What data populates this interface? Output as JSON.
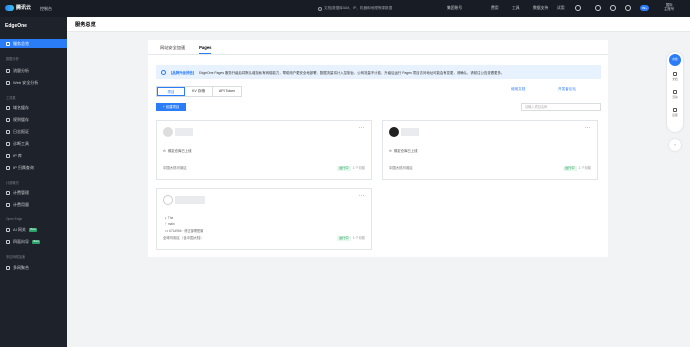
{
  "topbar": {
    "logo": "腾讯云",
    "console": "控制台",
    "search_placeholder": "文档|数据库IAM、IP、机器和地理等源数据",
    "nav": [
      "集团账号",
      "费用",
      "工具",
      "数据支持",
      "试用"
    ],
    "notif_count": "99+",
    "user_line1": "国际",
    "user_line2": "主账号"
  },
  "sidebar": {
    "title": "EdgeOne",
    "items": [
      {
        "label": "服务总览",
        "active": true
      },
      {
        "label": "数据分析"
      },
      {
        "label": "流量分析"
      },
      {
        "label": "Web 安全分析"
      },
      {
        "label": "域名缓存"
      },
      {
        "label": "规则缓存"
      },
      {
        "label": "日志报证"
      },
      {
        "label": "诊断工具"
      },
      {
        "label": "IP 库"
      },
      {
        "label": "IP 归属查询"
      },
      {
        "label": "计费管理"
      },
      {
        "label": "计费用量"
      },
      {
        "label": "AI 网关",
        "badge": "Beta"
      },
      {
        "label": "四面向导",
        "badge": "Beta"
      },
      {
        "label": "多网聚合"
      }
    ],
    "sections": [
      "数据分析",
      "工具集",
      "计费概况",
      "Open Edge",
      "多边网络加速"
    ]
  },
  "page": {
    "title": "服务总览"
  },
  "tabs": [
    "网站安全加速",
    "Pages"
  ],
  "notice": {
    "highlight": "【品牌升级预告】",
    "text": "EdgeOne Pages 服务升级后将默认增加私有网络能力，帮助用户更安全地部署，数据流量将计入控制台，公网流量不计费，升级后运行 Pages 项目访问地址可能会有变更，请确认，请前往公告查看更多。"
  },
  "segments": [
    "项目",
    "KV 存储",
    "API Token"
  ],
  "links": [
    "使用文档",
    "开发者论坛"
  ],
  "create_label": "+ 创建项目",
  "search_placeholder": "请输入项目名称",
  "cards": [
    {
      "github": "绑定仓库已上线",
      "region": "中国大陆可用区",
      "status": "运行中",
      "ago": "1 个月前"
    },
    {
      "github": "绑定仓库已上线",
      "region": "中国大陆可用区",
      "status": "运行中",
      "ago": "1 个月前"
    },
    {
      "repo": "The",
      "branch": "main",
      "commit": "671d96b  · 修正部署配置",
      "region": "全球可用区（含中国大陆）",
      "status": "运行中",
      "ago": "1 个月前"
    }
  ],
  "rail": {
    "chat": "在线",
    "items": [
      "文档",
      "活动",
      "反馈"
    ]
  }
}
